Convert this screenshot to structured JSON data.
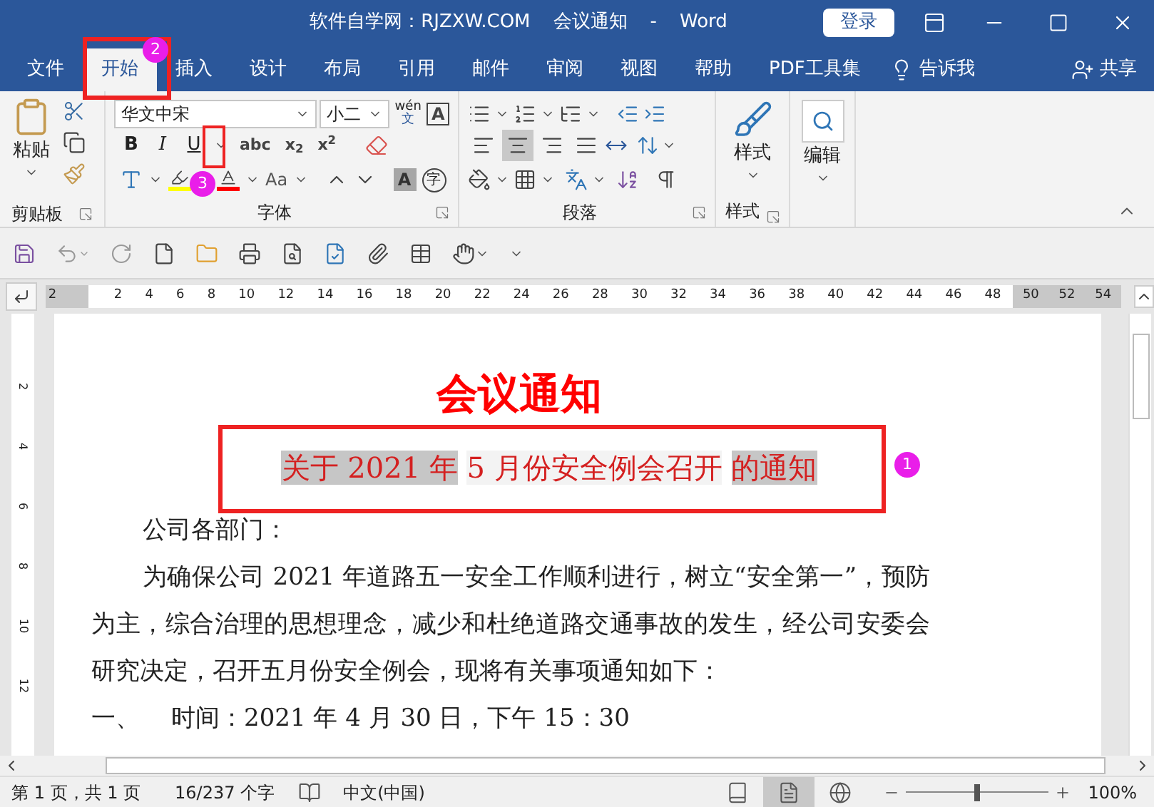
{
  "window": {
    "title_parts": [
      "软件自学网：RJZXW.COM",
      "会议通知",
      "-",
      "Word"
    ],
    "login_button": "登录"
  },
  "tabs": [
    {
      "label": "文件",
      "selected": false
    },
    {
      "label": "开始",
      "selected": true
    },
    {
      "label": "插入",
      "selected": false
    },
    {
      "label": "设计",
      "selected": false
    },
    {
      "label": "布局",
      "selected": false
    },
    {
      "label": "引用",
      "selected": false
    },
    {
      "label": "邮件",
      "selected": false
    },
    {
      "label": "审阅",
      "selected": false
    },
    {
      "label": "视图",
      "selected": false
    },
    {
      "label": "帮助",
      "selected": false
    },
    {
      "label": "PDF工具集",
      "selected": false
    }
  ],
  "tell_me": "告诉我",
  "share": "共享",
  "ribbon": {
    "clipboard": {
      "paste": "粘贴",
      "label": "剪贴板"
    },
    "font": {
      "font_name": "华文中宋",
      "font_size": "小二",
      "phonetic_top": "wén",
      "phonetic_bottom": "文",
      "boxed_letter": "A",
      "format_buttons": [
        "B",
        "I",
        "U"
      ],
      "script_buttons": [
        "abc",
        "x$_{2}$",
        "x$^{2}$"
      ],
      "change_case": "Aa",
      "shading_letter": "A",
      "enclose_char": "字",
      "label": "字体"
    },
    "paragraph": {
      "alignment": [
        {
          "selected": false
        },
        {
          "selected": true
        },
        {
          "selected": false
        },
        {
          "selected": false
        }
      ],
      "label": "段落"
    },
    "styles": {
      "button": "样式",
      "label": "样式"
    },
    "editing": {
      "button": "编辑"
    }
  },
  "ruler": {
    "left_margin_numbers": [
      "2"
    ],
    "numbers": [
      "2",
      "4",
      "6",
      "8",
      "10",
      "12",
      "14",
      "16",
      "18",
      "20",
      "22",
      "24",
      "26",
      "28",
      "30",
      "32",
      "34",
      "36",
      "38",
      "40",
      "42",
      "44",
      "46",
      "48"
    ],
    "right_margin_numbers": [
      "50",
      "52",
      "54"
    ]
  },
  "vertical_ruler": [
    "2",
    "4",
    "6",
    "8",
    "10",
    "12"
  ],
  "document": {
    "heading": "会议通知",
    "subtitle_segments": [
      {
        "text": "关于 2021 年",
        "highlighted": true
      },
      {
        "text": "5 月份安全例会召开",
        "highlighted": false
      },
      {
        "text": "的通知",
        "highlighted": true
      }
    ],
    "salutation": "公司各部门：",
    "paragraph": "为确保公司 2021 年道路五一安全工作顺利进行，树立“安全第一”，预防为主，综合治理的思想理念，减少和杜绝道路交通事故的发生，经公司安委会研究决定，召开五月份安全例会，现将有关事项通知如下：",
    "item": {
      "number": "一、",
      "text": "时间：2021 年 4 月 30 日，下午 15：30"
    }
  },
  "annotations": [
    "1",
    "2",
    "3"
  ],
  "status_bar": {
    "page": "第 1 页，共 1 页",
    "words": "16/237 个字",
    "language": "中文(中国)",
    "views": [
      {
        "kind": "read",
        "selected": false
      },
      {
        "kind": "print",
        "selected": true
      },
      {
        "kind": "web",
        "selected": false
      }
    ],
    "zoom": {
      "level": 0.5,
      "reading": "100%"
    }
  }
}
